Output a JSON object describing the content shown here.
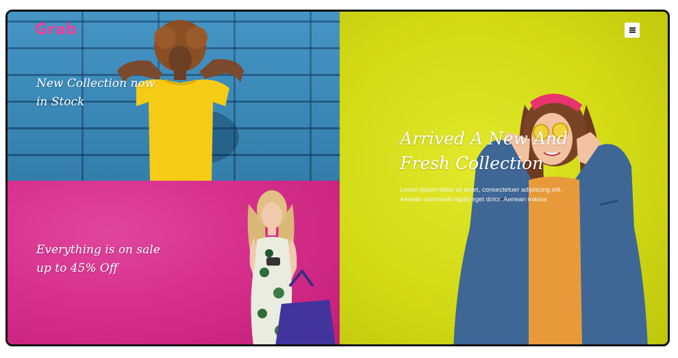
{
  "brand": {
    "logo": "Grab",
    "accent": "#ec3f9c"
  },
  "header": {
    "menu_icon": "hamburger-menu-icon"
  },
  "banners": {
    "top_left": {
      "heading_line1": "New Collection now",
      "heading_line2": "in Stock",
      "background": "#3a8fc2"
    },
    "bottom_left": {
      "heading_line1": "Everything is on sale",
      "heading_line2": "up to 45% Off",
      "background": "#d62f8c"
    },
    "right": {
      "heading_line1": "Arrived A New And",
      "heading_line2": "Fresh Collection",
      "body_line1": "Lorem ipsum dolor sit amet, consectetuer adipiscing elit.",
      "body_line2": "Aenean commodo ligula eget dolor. Aenean massa",
      "background": "#d2d914"
    }
  }
}
